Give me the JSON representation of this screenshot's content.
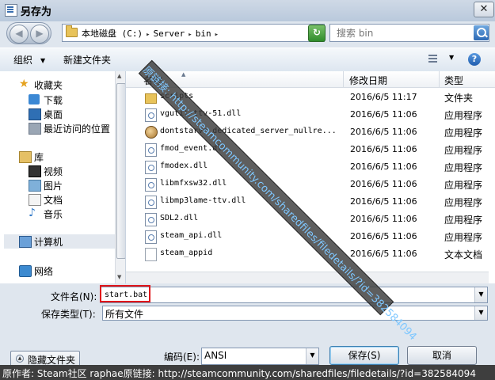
{
  "window": {
    "title": "另存为",
    "close_glyph": "✕"
  },
  "nav": {
    "back_glyph": "◀",
    "forward_glyph": "▶",
    "breadcrumb": [
      "本地磁盘 (C:)",
      "Server",
      "bin"
    ],
    "refresh_glyph": "↻",
    "search_placeholder": "搜索 bin"
  },
  "toolbar": {
    "organize": "组织",
    "new_folder": "新建文件夹",
    "help_glyph": "?"
  },
  "sidebar": {
    "favorites": {
      "label": "收藏夹",
      "items": [
        "下载",
        "桌面",
        "最近访问的位置"
      ]
    },
    "libraries": {
      "label": "库",
      "items": [
        "视频",
        "图片",
        "文档",
        "音乐"
      ]
    },
    "computer": "计算机",
    "network": "网络"
  },
  "columns": {
    "name": "名称",
    "date": "修改日期",
    "type": "类型"
  },
  "files": [
    {
      "name": "scripts",
      "date": "2016/6/5 11:17",
      "type": "文件夹",
      "icon": "folder-icon"
    },
    {
      "name": "vgutil-ttv-51.dll",
      "date": "2016/6/5 11:06",
      "type": "应用程序",
      "icon": "dll-icon"
    },
    {
      "name": "dontstarve_dedicated_server_nullre...",
      "date": "2016/6/5 11:06",
      "type": "应用程序",
      "icon": "exe-icon"
    },
    {
      "name": "fmod_event.dll",
      "date": "2016/6/5 11:06",
      "type": "应用程序",
      "icon": "dll-icon"
    },
    {
      "name": "fmodex.dll",
      "date": "2016/6/5 11:06",
      "type": "应用程序",
      "icon": "dll-icon"
    },
    {
      "name": "libmfxsw32.dll",
      "date": "2016/6/5 11:06",
      "type": "应用程序",
      "icon": "dll-icon"
    },
    {
      "name": "libmp3lame-ttv.dll",
      "date": "2016/6/5 11:06",
      "type": "应用程序",
      "icon": "dll-icon"
    },
    {
      "name": "SDL2.dll",
      "date": "2016/6/5 11:06",
      "type": "应用程序",
      "icon": "dll-icon"
    },
    {
      "name": "steam_api.dll",
      "date": "2016/6/5 11:06",
      "type": "应用程序",
      "icon": "dll-icon"
    },
    {
      "name": "steam_appid",
      "date": "2016/6/5 11:06",
      "type": "文本文档",
      "icon": "file-icon"
    }
  ],
  "form": {
    "filename_label": "文件名(N):",
    "filename_value": "start.bat",
    "filetype_label": "保存类型(T):",
    "filetype_value": "所有文件",
    "hide_folders": "隐藏文件夹",
    "encoding_label": "编码(E):",
    "encoding_value": "ANSI",
    "save": "保存(S)",
    "cancel": "取消"
  },
  "watermark": "原链接: http://steamcommunity.com/sharedfiles/filedetails/?id=382584094",
  "footer": "原作者: Steam社区 raphae原链接: http://steamcommunity.com/sharedfiles/filedetails/?id=382584094"
}
